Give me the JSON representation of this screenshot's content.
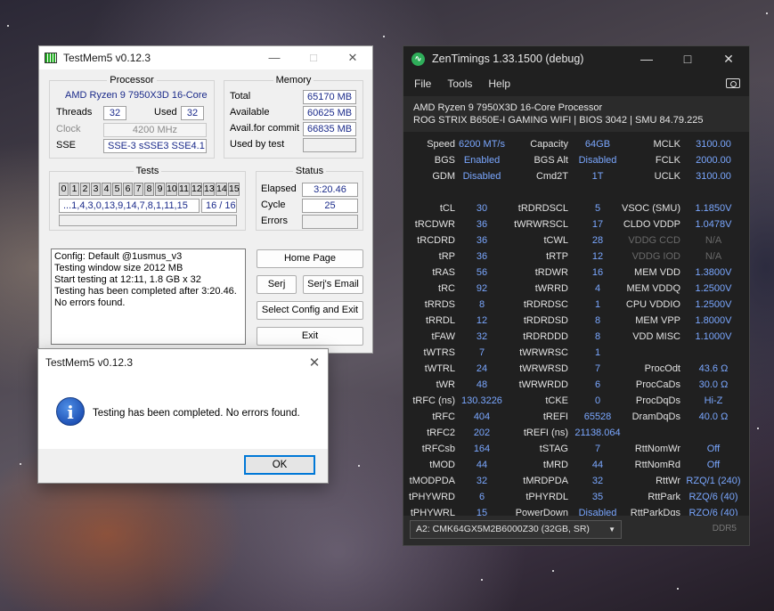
{
  "testmem": {
    "title": "TestMem5 v0.12.3",
    "processor": {
      "group_label": "Processor",
      "cpu_name": "AMD Ryzen 9 7950X3D 16-Core",
      "threads_label": "Threads",
      "threads": "32",
      "used_label": "Used",
      "used": "32",
      "clock_label": "Clock",
      "clock": "4200 MHz",
      "sse_label": "SSE",
      "sse": "SSE-3 sSSE3 SSE4.1"
    },
    "memory": {
      "group_label": "Memory",
      "total_label": "Total",
      "total": "65170 MB",
      "available_label": "Available",
      "available": "60625 MB",
      "commit_label": "Avail.for commit",
      "commit": "66835 MB",
      "used_by_test_label": "Used by test",
      "used_by_test": ""
    },
    "tests": {
      "group_label": "Tests",
      "cells": [
        "0",
        "1",
        "2",
        "3",
        "4",
        "5",
        "6",
        "7",
        "8",
        "9",
        "10",
        "11",
        "12",
        "13",
        "14",
        "15"
      ],
      "sequence": "...1,4,3,0,13,9,14,7,8,1,11,15",
      "progress": "16 / 16"
    },
    "status": {
      "group_label": "Status",
      "elapsed_label": "Elapsed",
      "elapsed": "3:20.46",
      "cycle_label": "Cycle",
      "cycle": "25",
      "errors_label": "Errors",
      "errors": ""
    },
    "log": [
      "Config: Default @1usmus_v3",
      "Testing window size 2012 MB",
      "Start testing at 12:11, 1.8 GB x 32",
      "Testing has been completed after 3:20.46.",
      "No errors found."
    ],
    "buttons": {
      "home": "Home Page",
      "serj": "Serj",
      "email": "Serj's Email",
      "select_config": "Select Config and Exit",
      "exit": "Exit"
    }
  },
  "dialog": {
    "title": "TestMem5 v0.12.3",
    "message": "Testing has been completed. No errors found.",
    "ok": "OK",
    "icon": "info-icon"
  },
  "zen": {
    "title": "ZenTimings 1.33.1500 (debug)",
    "menu": [
      "File",
      "Tools",
      "Help"
    ],
    "cpu": "AMD Ryzen 9 7950X3D 16-Core Processor",
    "board": "ROG STRIX B650E-I GAMING WIFI | BIOS 3042 | SMU 84.79.225",
    "rows": [
      [
        [
          "Speed",
          "6200 MT/s"
        ],
        [
          "Capacity",
          "64GB"
        ],
        [
          "MCLK",
          "3100.00"
        ]
      ],
      [
        [
          "BGS",
          "Enabled"
        ],
        [
          "BGS Alt",
          "Disabled"
        ],
        [
          "FCLK",
          "2000.00"
        ]
      ],
      [
        [
          "GDM",
          "Disabled"
        ],
        [
          "Cmd2T",
          "1T"
        ],
        [
          "UCLK",
          "3100.00"
        ]
      ],
      [],
      [
        [
          "tCL",
          "30"
        ],
        [
          "tRDRDSCL",
          "5"
        ],
        [
          "VSOC (SMU)",
          "1.1850V"
        ]
      ],
      [
        [
          "tRCDWR",
          "36"
        ],
        [
          "tWRWRSCL",
          "17"
        ],
        [
          "CLDO VDDP",
          "1.0478V"
        ]
      ],
      [
        [
          "tRCDRD",
          "36"
        ],
        [
          "tCWL",
          "28"
        ],
        [
          "VDDG CCD",
          "N/A"
        ]
      ],
      [
        [
          "tRP",
          "36"
        ],
        [
          "tRTP",
          "12"
        ],
        [
          "VDDG IOD",
          "N/A"
        ]
      ],
      [
        [
          "tRAS",
          "56"
        ],
        [
          "tRDWR",
          "16"
        ],
        [
          "MEM VDD",
          "1.3800V"
        ]
      ],
      [
        [
          "tRC",
          "92"
        ],
        [
          "tWRRD",
          "4"
        ],
        [
          "MEM VDDQ",
          "1.2500V"
        ]
      ],
      [
        [
          "tRRDS",
          "8"
        ],
        [
          "tRDRDSC",
          "1"
        ],
        [
          "CPU VDDIO",
          "1.2500V"
        ]
      ],
      [
        [
          "tRRDL",
          "12"
        ],
        [
          "tRDRDSD",
          "8"
        ],
        [
          "MEM VPP",
          "1.8000V"
        ]
      ],
      [
        [
          "tFAW",
          "32"
        ],
        [
          "tRDRDDD",
          "8"
        ],
        [
          "VDD MISC",
          "1.1000V"
        ]
      ],
      [
        [
          "tWTRS",
          "7"
        ],
        [
          "tWRWRSC",
          "1"
        ],
        [
          "",
          ""
        ]
      ],
      [
        [
          "tWTRL",
          "24"
        ],
        [
          "tWRWRSD",
          "7"
        ],
        [
          "ProcOdt",
          "43.6 Ω"
        ]
      ],
      [
        [
          "tWR",
          "48"
        ],
        [
          "tWRWRDD",
          "6"
        ],
        [
          "ProcCaDs",
          "30.0 Ω"
        ]
      ],
      [
        [
          "tRFC (ns)",
          "130.3226"
        ],
        [
          "tCKE",
          "0"
        ],
        [
          "ProcDqDs",
          "Hi-Z"
        ]
      ],
      [
        [
          "tRFC",
          "404"
        ],
        [
          "tREFI",
          "65528"
        ],
        [
          "DramDqDs",
          "40.0 Ω"
        ]
      ],
      [
        [
          "tRFC2",
          "202"
        ],
        [
          "tREFI (ns)",
          "21138.064"
        ],
        [
          "",
          ""
        ]
      ],
      [
        [
          "tRFCsb",
          "164"
        ],
        [
          "tSTAG",
          "7"
        ],
        [
          "RttNomWr",
          "Off"
        ]
      ],
      [
        [
          "tMOD",
          "44"
        ],
        [
          "tMRD",
          "44"
        ],
        [
          "RttNomRd",
          "Off"
        ]
      ],
      [
        [
          "tMODPDA",
          "32"
        ],
        [
          "tMRDPDA",
          "32"
        ],
        [
          "RttWr",
          "RZQ/1 (240)"
        ]
      ],
      [
        [
          "tPHYWRD",
          "6"
        ],
        [
          "tPHYRDL",
          "35"
        ],
        [
          "RttPark",
          "RZQ/6 (40)"
        ]
      ],
      [
        [
          "tPHYWRL",
          "15"
        ],
        [
          "PowerDown",
          "Disabled"
        ],
        [
          "RttParkDqs",
          "RZQ/6 (40)"
        ]
      ]
    ],
    "dimm_select": "A2: CMK64GX5M2B6000Z30 (32GB, SR)",
    "ddr_label": "DDR5"
  }
}
